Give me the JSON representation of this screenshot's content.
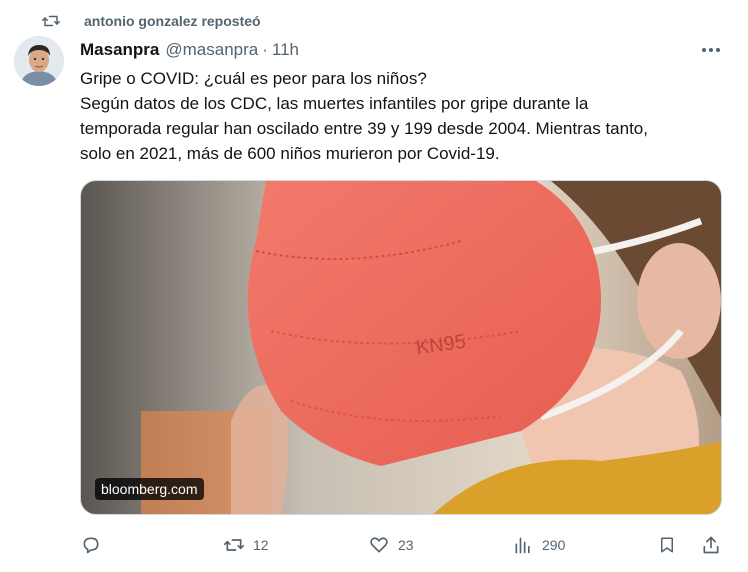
{
  "repost": {
    "text": "antonio gonzalez reposteó",
    "icon": "repost-icon"
  },
  "tweet": {
    "author_name": "Masanpra",
    "handle": "@masanpra",
    "separator": "·",
    "time": "11h",
    "lines": [
      "Gripe o COVID: ¿cuál es peor para los niños?",
      "Según datos de los CDC, las muertes infantiles por gripe durante la",
      "temporada regular han oscilado entre 39 y 199 desde 2004. Mientras tanto,",
      "solo en 2021, más de 600 niños murieron por Covid-19."
    ],
    "media": {
      "source": "bloomberg.com",
      "mask_text": "KN95",
      "mask_color": "#f06a5c"
    }
  },
  "actions": {
    "reply": {
      "icon": "reply-icon"
    },
    "retweet": {
      "icon": "retweet-icon",
      "count": "12"
    },
    "like": {
      "icon": "heart-icon",
      "count": "23"
    },
    "views": {
      "icon": "views-icon",
      "count": "290"
    },
    "bookmark": {
      "icon": "bookmark-icon"
    },
    "share": {
      "icon": "share-icon"
    }
  },
  "colors": {
    "text": "#0f1419",
    "secondary": "#536471",
    "border": "#cfd9de"
  }
}
